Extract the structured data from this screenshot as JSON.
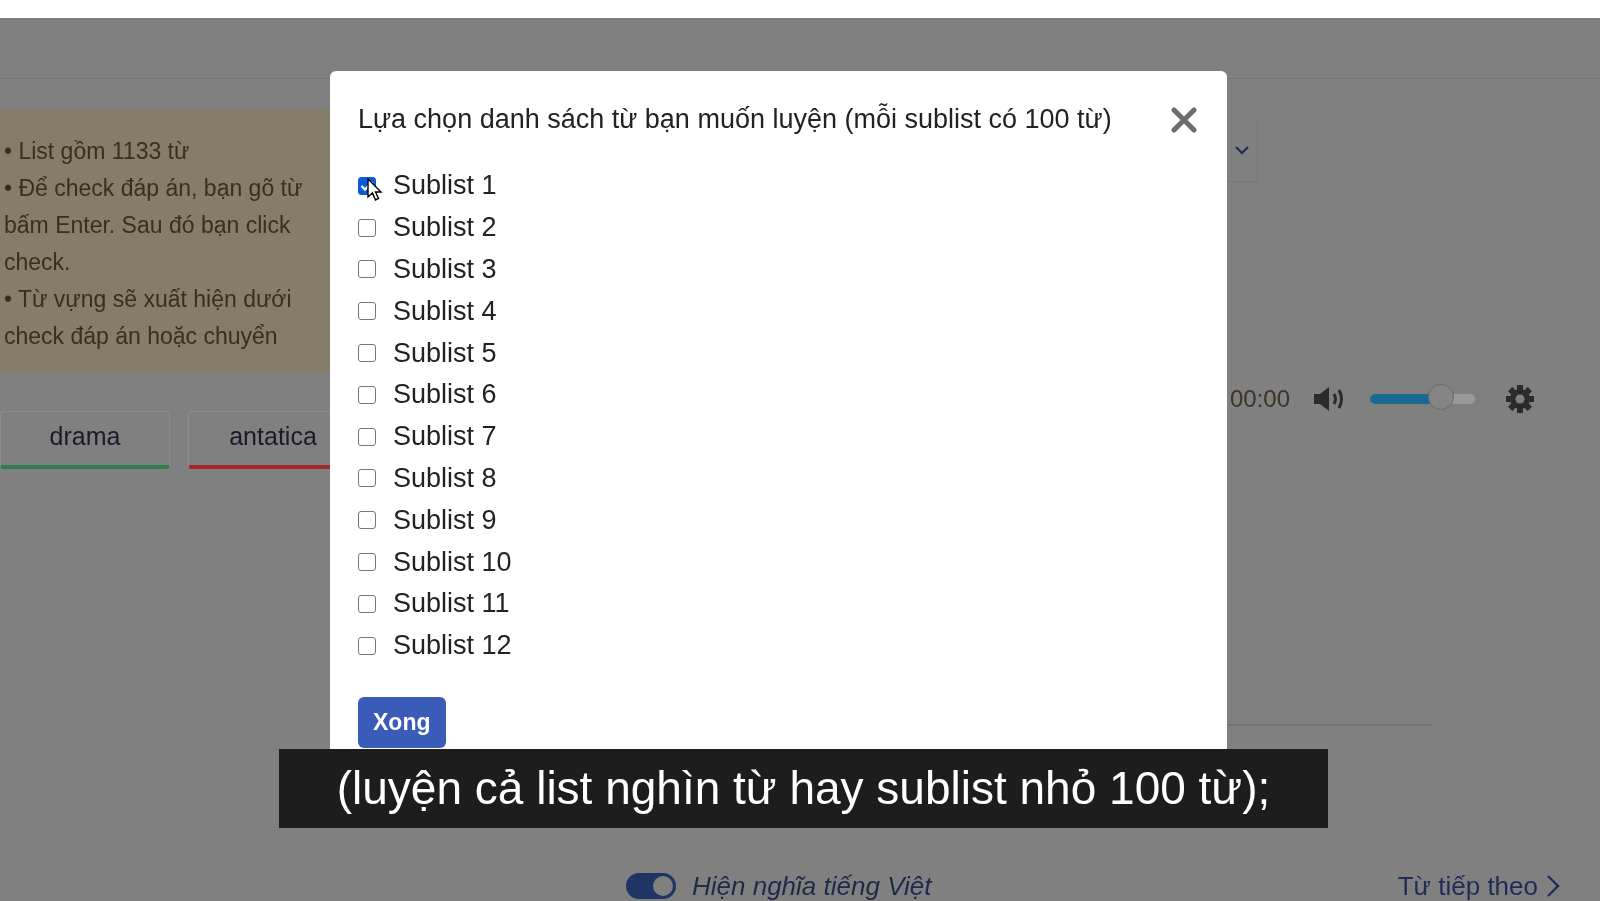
{
  "background": {
    "instructions": [
      "• List gồm 1133 từ",
      "• Để check đáp án, bạn gõ từ",
      "bấm Enter. Sau đó bạn click",
      "check.",
      "• Từ vựng sẽ xuất hiện dưới",
      "check đáp án hoặc chuyển"
    ],
    "word_tabs": [
      {
        "label": "drama",
        "color": "#2f7d4f"
      },
      {
        "label": "antatica",
        "color": "#a3262b"
      }
    ],
    "player": {
      "time": "00:00",
      "volume": {
        "level": 0.68
      }
    },
    "show_meaning": {
      "label": "Hiện nghĩa tiếng Việt",
      "on": true
    },
    "next_link": "Từ tiếp theo"
  },
  "dialog": {
    "title": "Lựa chọn danh sách từ bạn muốn luyện (mỗi sublist có 100 từ)",
    "items": [
      {
        "label": "Sublist 1",
        "checked": true
      },
      {
        "label": "Sublist 2",
        "checked": false
      },
      {
        "label": "Sublist 3",
        "checked": false
      },
      {
        "label": "Sublist 4",
        "checked": false
      },
      {
        "label": "Sublist 5",
        "checked": false
      },
      {
        "label": "Sublist 6",
        "checked": false
      },
      {
        "label": "Sublist 7",
        "checked": false
      },
      {
        "label": "Sublist 8",
        "checked": false
      },
      {
        "label": "Sublist 9",
        "checked": false
      },
      {
        "label": "Sublist 10",
        "checked": false
      },
      {
        "label": "Sublist 11",
        "checked": false
      },
      {
        "label": "Sublist 12",
        "checked": false
      }
    ],
    "done_button": "Xong"
  },
  "caption": "(luyện cả list nghìn từ hay sublist nhỏ 100 từ);"
}
